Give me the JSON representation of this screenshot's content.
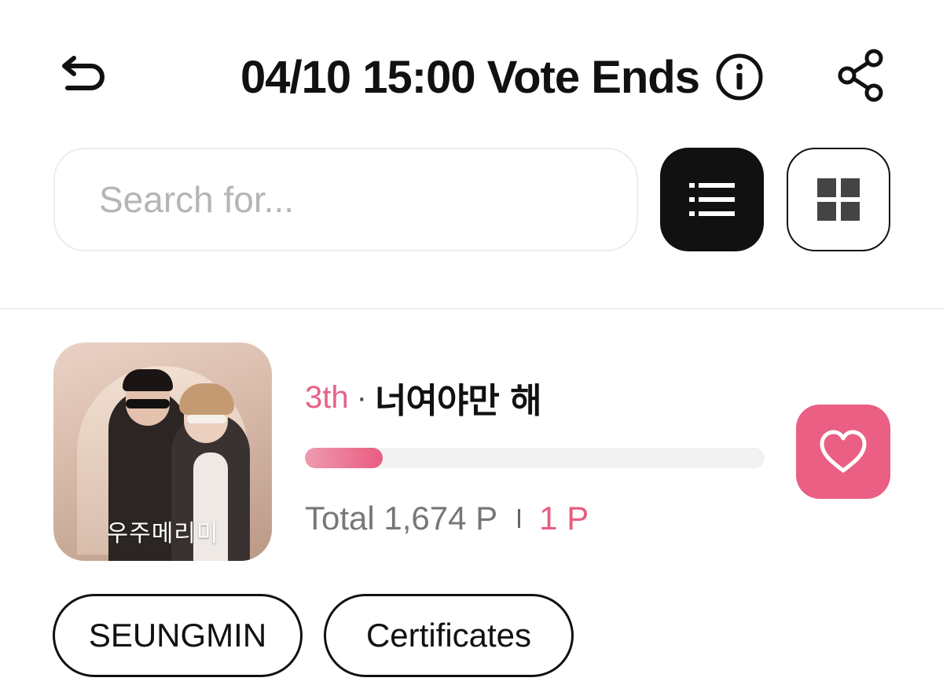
{
  "header": {
    "title": "04/10 15:00 Vote Ends",
    "back_icon": "undo-arrow-icon",
    "info_icon": "info-circle-icon",
    "share_icon": "share-icon"
  },
  "search": {
    "placeholder": "Search for...",
    "value": ""
  },
  "view_toggle": {
    "list_icon": "list-icon",
    "grid_icon": "grid-icon",
    "active": "list"
  },
  "entry": {
    "album_title_text": "우주메리미",
    "rank": "3th",
    "separator": "·",
    "song_title": "너여야만 해",
    "progress": 0.17,
    "total_label": "Total 1,674 P",
    "my_points": "1 P",
    "vote_icon": "heart-icon"
  },
  "tags": [
    {
      "label": "SEUNGMIN"
    },
    {
      "label": "Certificates"
    }
  ],
  "colors": {
    "accent": "#e85c80",
    "dark": "#111111",
    "muted": "#777777"
  }
}
